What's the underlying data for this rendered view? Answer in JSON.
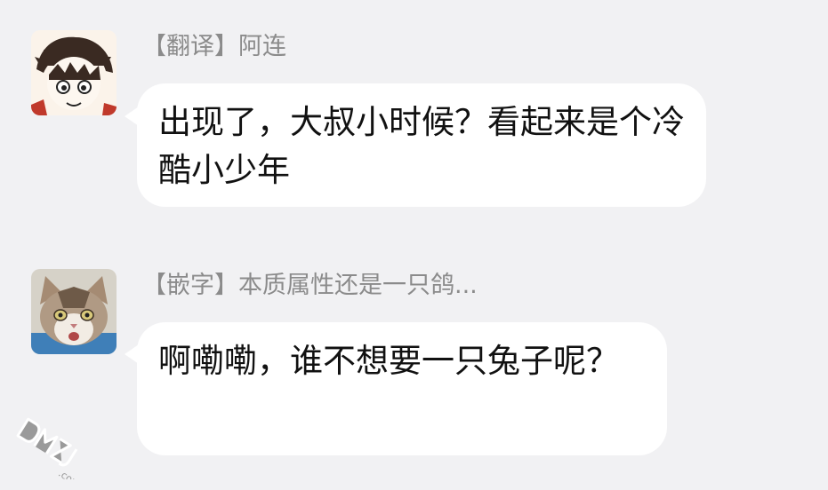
{
  "messages": [
    {
      "sender": "【翻译】阿连",
      "text": "出现了，大叔小时候？看起来是个冷酷小少年",
      "avatar_icon": "anime-boy-avatar-icon"
    },
    {
      "sender": "【嵌字】本质属性还是一只鸽...",
      "text": "啊嘞嘞，谁不想要一只兔子呢？",
      "avatar_icon": "cat-avatar-icon"
    }
  ],
  "watermark": {
    "text": "DMZJ.com",
    "icon": "dmzj-watermark-icon"
  },
  "colors": {
    "background": "#f1f1f3",
    "bubble": "#ffffff",
    "sender": "#8b8b8b",
    "text": "#111111"
  }
}
